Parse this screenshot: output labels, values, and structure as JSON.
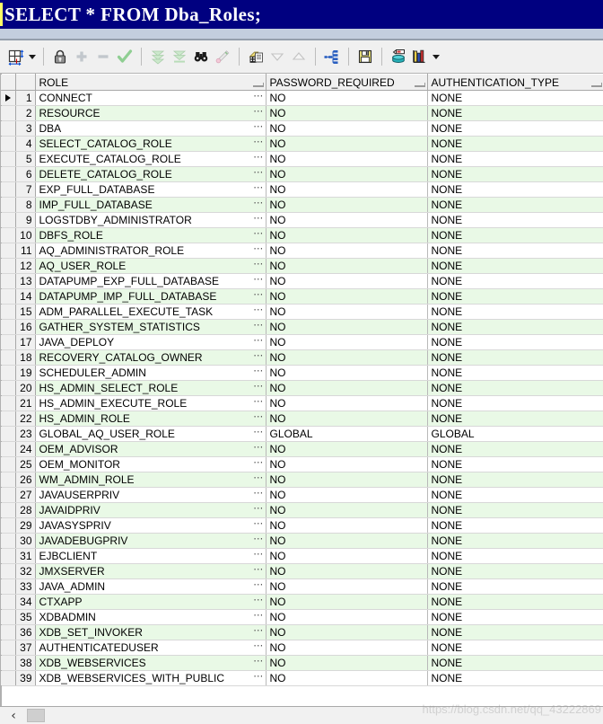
{
  "sql_bar": {
    "query": "SELECT * FROM Dba_Roles;"
  },
  "toolbar": {
    "items": [
      {
        "name": "column-sizing-icon",
        "label": "Column Sizing"
      },
      {
        "name": "chevron-down-icon",
        "label": "More"
      },
      {
        "name": "lock-icon",
        "label": "Lock"
      },
      {
        "name": "plus-icon",
        "label": "Insert Row"
      },
      {
        "name": "minus-icon",
        "label": "Delete Row"
      },
      {
        "name": "check-icon",
        "label": "Commit"
      },
      {
        "name": "fetch-next-icon",
        "label": "Fetch Next"
      },
      {
        "name": "fetch-last-icon",
        "label": "Fetch Last"
      },
      {
        "name": "binoculars-icon",
        "label": "Find"
      },
      {
        "name": "highlighter-icon",
        "label": "Highlight"
      },
      {
        "name": "copy-documents-icon",
        "label": "Copy"
      },
      {
        "name": "triangle-down-icon",
        "label": "Sort Descending"
      },
      {
        "name": "triangle-up-icon",
        "label": "Sort Ascending"
      },
      {
        "name": "tree-hierarchy-icon",
        "label": "Explain Plan"
      },
      {
        "name": "save-floppy-icon",
        "label": "Save"
      },
      {
        "name": "database-export-icon",
        "label": "Export Data"
      },
      {
        "name": "bar-chart-icon",
        "label": "Chart"
      },
      {
        "name": "chevron-down-icon-2",
        "label": "Chart Options"
      }
    ]
  },
  "grid": {
    "columns": [
      "",
      "",
      "ROLE",
      "PASSWORD_REQUIRED",
      "AUTHENTICATION_TYPE"
    ],
    "rows": [
      {
        "n": "1",
        "role": "CONNECT",
        "pwd": "NO",
        "auth": "NONE",
        "current": true
      },
      {
        "n": "2",
        "role": "RESOURCE",
        "pwd": "NO",
        "auth": "NONE"
      },
      {
        "n": "3",
        "role": "DBA",
        "pwd": "NO",
        "auth": "NONE"
      },
      {
        "n": "4",
        "role": "SELECT_CATALOG_ROLE",
        "pwd": "NO",
        "auth": "NONE"
      },
      {
        "n": "5",
        "role": "EXECUTE_CATALOG_ROLE",
        "pwd": "NO",
        "auth": "NONE"
      },
      {
        "n": "6",
        "role": "DELETE_CATALOG_ROLE",
        "pwd": "NO",
        "auth": "NONE"
      },
      {
        "n": "7",
        "role": "EXP_FULL_DATABASE",
        "pwd": "NO",
        "auth": "NONE"
      },
      {
        "n": "8",
        "role": "IMP_FULL_DATABASE",
        "pwd": "NO",
        "auth": "NONE"
      },
      {
        "n": "9",
        "role": "LOGSTDBY_ADMINISTRATOR",
        "pwd": "NO",
        "auth": "NONE"
      },
      {
        "n": "10",
        "role": "DBFS_ROLE",
        "pwd": "NO",
        "auth": "NONE"
      },
      {
        "n": "11",
        "role": "AQ_ADMINISTRATOR_ROLE",
        "pwd": "NO",
        "auth": "NONE"
      },
      {
        "n": "12",
        "role": "AQ_USER_ROLE",
        "pwd": "NO",
        "auth": "NONE"
      },
      {
        "n": "13",
        "role": "DATAPUMP_EXP_FULL_DATABASE",
        "pwd": "NO",
        "auth": "NONE"
      },
      {
        "n": "14",
        "role": "DATAPUMP_IMP_FULL_DATABASE",
        "pwd": "NO",
        "auth": "NONE"
      },
      {
        "n": "15",
        "role": "ADM_PARALLEL_EXECUTE_TASK",
        "pwd": "NO",
        "auth": "NONE"
      },
      {
        "n": "16",
        "role": "GATHER_SYSTEM_STATISTICS",
        "pwd": "NO",
        "auth": "NONE"
      },
      {
        "n": "17",
        "role": "JAVA_DEPLOY",
        "pwd": "NO",
        "auth": "NONE"
      },
      {
        "n": "18",
        "role": "RECOVERY_CATALOG_OWNER",
        "pwd": "NO",
        "auth": "NONE"
      },
      {
        "n": "19",
        "role": "SCHEDULER_ADMIN",
        "pwd": "NO",
        "auth": "NONE"
      },
      {
        "n": "20",
        "role": "HS_ADMIN_SELECT_ROLE",
        "pwd": "NO",
        "auth": "NONE"
      },
      {
        "n": "21",
        "role": "HS_ADMIN_EXECUTE_ROLE",
        "pwd": "NO",
        "auth": "NONE"
      },
      {
        "n": "22",
        "role": "HS_ADMIN_ROLE",
        "pwd": "NO",
        "auth": "NONE"
      },
      {
        "n": "23",
        "role": "GLOBAL_AQ_USER_ROLE",
        "pwd": "GLOBAL",
        "auth": "GLOBAL"
      },
      {
        "n": "24",
        "role": "OEM_ADVISOR",
        "pwd": "NO",
        "auth": "NONE"
      },
      {
        "n": "25",
        "role": "OEM_MONITOR",
        "pwd": "NO",
        "auth": "NONE"
      },
      {
        "n": "26",
        "role": "WM_ADMIN_ROLE",
        "pwd": "NO",
        "auth": "NONE"
      },
      {
        "n": "27",
        "role": "JAVAUSERPRIV",
        "pwd": "NO",
        "auth": "NONE"
      },
      {
        "n": "28",
        "role": "JAVAIDPRIV",
        "pwd": "NO",
        "auth": "NONE"
      },
      {
        "n": "29",
        "role": "JAVASYSPRIV",
        "pwd": "NO",
        "auth": "NONE"
      },
      {
        "n": "30",
        "role": "JAVADEBUGPRIV",
        "pwd": "NO",
        "auth": "NONE"
      },
      {
        "n": "31",
        "role": "EJBCLIENT",
        "pwd": "NO",
        "auth": "NONE"
      },
      {
        "n": "32",
        "role": "JMXSERVER",
        "pwd": "NO",
        "auth": "NONE"
      },
      {
        "n": "33",
        "role": "JAVA_ADMIN",
        "pwd": "NO",
        "auth": "NONE"
      },
      {
        "n": "34",
        "role": "CTXAPP",
        "pwd": "NO",
        "auth": "NONE"
      },
      {
        "n": "35",
        "role": "XDBADMIN",
        "pwd": "NO",
        "auth": "NONE"
      },
      {
        "n": "36",
        "role": "XDB_SET_INVOKER",
        "pwd": "NO",
        "auth": "NONE"
      },
      {
        "n": "37",
        "role": "AUTHENTICATEDUSER",
        "pwd": "NO",
        "auth": "NONE"
      },
      {
        "n": "38",
        "role": "XDB_WEBSERVICES",
        "pwd": "NO",
        "auth": "NONE"
      },
      {
        "n": "39",
        "role": "XDB_WEBSERVICES_WITH_PUBLIC",
        "pwd": "NO",
        "auth": "NONE",
        "partial": true
      }
    ],
    "cell_menu_glyph": "⋯"
  },
  "scrollbar": {
    "left_arrow": "‹"
  },
  "watermark": {
    "text": "https://blog.csdn.net/qq_43222869"
  },
  "colors": {
    "sql_bar_bg": "#000080",
    "row_alt_bg": "#E9F9E6",
    "header_bg": "#F0F0F0"
  }
}
